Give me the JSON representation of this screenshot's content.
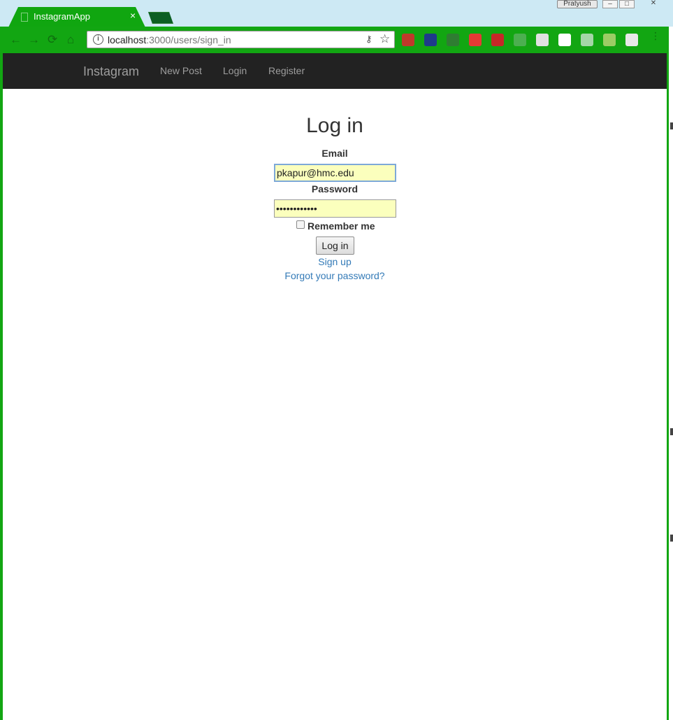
{
  "browser": {
    "tab_title": "InstagramApp",
    "tab_close": "×",
    "profile_name": "Pratyush",
    "url_host": "localhost",
    "url_path": ":3000/users/sign_in",
    "nav_back": "←",
    "nav_forward": "→",
    "nav_reload": "⟳",
    "nav_home": "⌂",
    "info_icon": "i",
    "key_icon": "⚷",
    "star_icon": "☆",
    "menu_icon": "⋮",
    "win_min": "–",
    "win_max": "□",
    "win_close": "✕",
    "accent_color": "#12a612",
    "extensions": [
      {
        "name": "ext-red-icon",
        "color": "#c0392b"
      },
      {
        "name": "ext-blue-icon",
        "color": "#1e3a8a"
      },
      {
        "name": "ext-green-icon",
        "color": "#2f7d32"
      },
      {
        "name": "ext-stop-icon",
        "color": "#e53935"
      },
      {
        "name": "ext-triangle-icon",
        "color": "#c62828"
      },
      {
        "name": "ext-r-icon",
        "color": "#4caf50"
      },
      {
        "name": "ext-doc-icon",
        "color": "#e0e0e0"
      },
      {
        "name": "ext-puzzle-icon",
        "color": "#ffffff"
      },
      {
        "name": "ext-h-icon",
        "color": "#a5d6a7"
      },
      {
        "name": "ext-w-icon",
        "color": "#9ccc65"
      },
      {
        "name": "ext-b-icon",
        "color": "#e8e8e8"
      }
    ]
  },
  "navbar": {
    "brand": "Instagram",
    "links": [
      "New Post",
      "Login",
      "Register"
    ],
    "background": "#222222"
  },
  "form": {
    "title": "Log in",
    "email_label": "Email",
    "email_value": "pkapur@hmc.edu",
    "password_label": "Password",
    "password_value": "••••••••••••",
    "remember_label": "Remember me",
    "remember_checked": false,
    "submit_label": "Log in",
    "signup_link": "Sign up",
    "forgot_link": "Forgot your password?",
    "input_bg": "#fbffbd",
    "link_color": "#337ab7"
  }
}
